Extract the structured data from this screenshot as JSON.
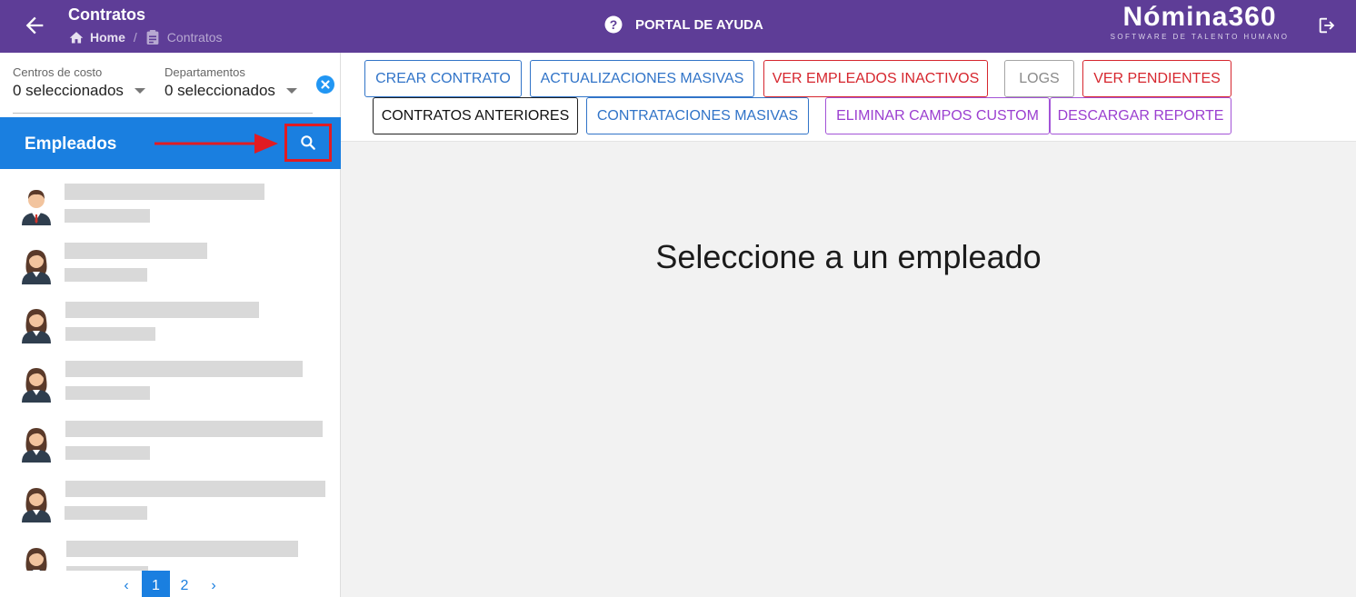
{
  "header": {
    "title": "Contratos",
    "breadcrumb": {
      "home": "Home",
      "current": "Contratos"
    },
    "help_label": "PORTAL DE AYUDA",
    "logo": {
      "name": "Nómina360",
      "tagline": "SOFTWARE DE TALENTO HUMANO"
    }
  },
  "sidebar": {
    "filters": [
      {
        "label": "Centros de costo",
        "value": "0 seleccionados"
      },
      {
        "label": "Departamentos",
        "value": "0 seleccionados"
      }
    ],
    "employees_title": "Empleados",
    "employees": [
      {
        "gender": "male"
      },
      {
        "gender": "female"
      },
      {
        "gender": "female"
      },
      {
        "gender": "female"
      },
      {
        "gender": "female"
      },
      {
        "gender": "female"
      },
      {
        "gender": "female"
      }
    ],
    "pagination": {
      "prev": "‹",
      "pages": [
        "1",
        "2"
      ],
      "current": "1",
      "next": "›"
    }
  },
  "toolbar": {
    "buttons": [
      {
        "label": "CREAR CONTRATO",
        "style": "blue"
      },
      {
        "label": "ACTUALIZACIONES MASIVAS",
        "style": "blue"
      },
      {
        "label": "VER EMPLEADOS INACTIVOS",
        "style": "red"
      },
      {
        "label": "LOGS",
        "style": "gray"
      },
      {
        "label": "VER PENDIENTES",
        "style": "red"
      },
      {
        "label": "CONTRATOS ANTERIORES",
        "style": "black"
      },
      {
        "label": "CONTRATACIONES MASIVAS",
        "style": "blue"
      },
      {
        "label": "ELIMINAR CAMPOS CUSTOM",
        "style": "purple"
      },
      {
        "label": "DESCARGAR REPORTE",
        "style": "purple"
      }
    ]
  },
  "main": {
    "placeholder": "Seleccione a un empleado"
  },
  "colors": {
    "header_bg": "#5e3d97",
    "accent_blue": "#1a7fe0",
    "danger_red": "#d6262e",
    "purple": "#9b3fd0",
    "highlight_red": "#e11b22"
  }
}
